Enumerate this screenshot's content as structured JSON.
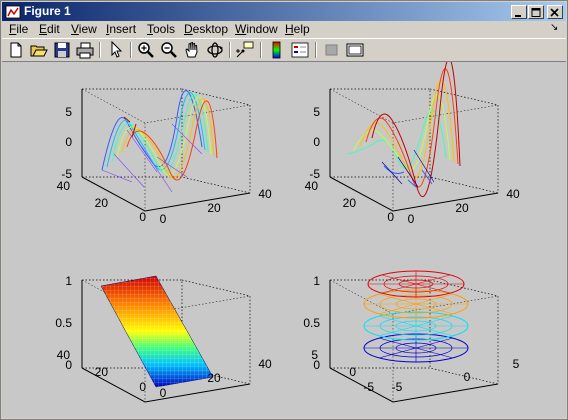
{
  "window": {
    "title": "Figure 1",
    "buttons": {
      "minimize": "_",
      "maximize": "□",
      "close": "×"
    }
  },
  "menubar": {
    "items": [
      {
        "label": "File",
        "accel": "F",
        "rest": "ile"
      },
      {
        "label": "Edit",
        "accel": "E",
        "rest": "dit"
      },
      {
        "label": "View",
        "accel": "V",
        "rest": "iew"
      },
      {
        "label": "Insert",
        "accel": "I",
        "rest": "nsert"
      },
      {
        "label": "Tools",
        "accel": "T",
        "rest": "ools"
      },
      {
        "label": "Desktop",
        "accel": "D",
        "rest": "esktop"
      },
      {
        "label": "Window",
        "accel": "W",
        "rest": "indow"
      },
      {
        "label": "Help",
        "accel": "H",
        "rest": "elp"
      }
    ],
    "dock_arrow": "↘"
  },
  "toolbar": {
    "buttons": [
      "new-figure-icon",
      "open-file-icon",
      "save-icon",
      "print-icon",
      "edit-plot-arrow-icon",
      "zoom-in-icon",
      "zoom-out-icon",
      "pan-hand-icon",
      "rotate-3d-icon",
      "data-cursor-icon",
      "insert-colorbar-icon",
      "insert-legend-icon",
      "hide-plot-tools-icon",
      "show-plot-tools-icon"
    ]
  },
  "colors": {
    "titlebar_start": "#0a246a",
    "titlebar_end": "#a6caf0",
    "figure_bg": "#c8c8c8",
    "axes_bg": "#c8c8c8",
    "colormap": "jet"
  },
  "plots": [
    {
      "name": "top-left",
      "z_ticks": [
        "5",
        "0",
        "-5"
      ],
      "y_ticks": [
        "40",
        "20",
        "0"
      ],
      "x_ticks": [
        "0",
        "20",
        "40"
      ]
    },
    {
      "name": "top-right",
      "z_ticks": [
        "5",
        "0",
        "-5"
      ],
      "y_ticks": [
        "40",
        "20",
        "0"
      ],
      "x_ticks": [
        "0",
        "20",
        "40"
      ]
    },
    {
      "name": "bottom-left",
      "z_ticks": [
        "1",
        "0.5",
        "0"
      ],
      "y_ticks": [
        "40",
        "20",
        "0"
      ],
      "x_ticks": [
        "0",
        "20",
        "40"
      ]
    },
    {
      "name": "bottom-right",
      "z_ticks": [
        "1",
        "0.5",
        "0"
      ],
      "y_ticks": [
        "5",
        "0",
        "-5"
      ],
      "x_ticks": [
        "-5",
        "0",
        "5"
      ]
    }
  ]
}
